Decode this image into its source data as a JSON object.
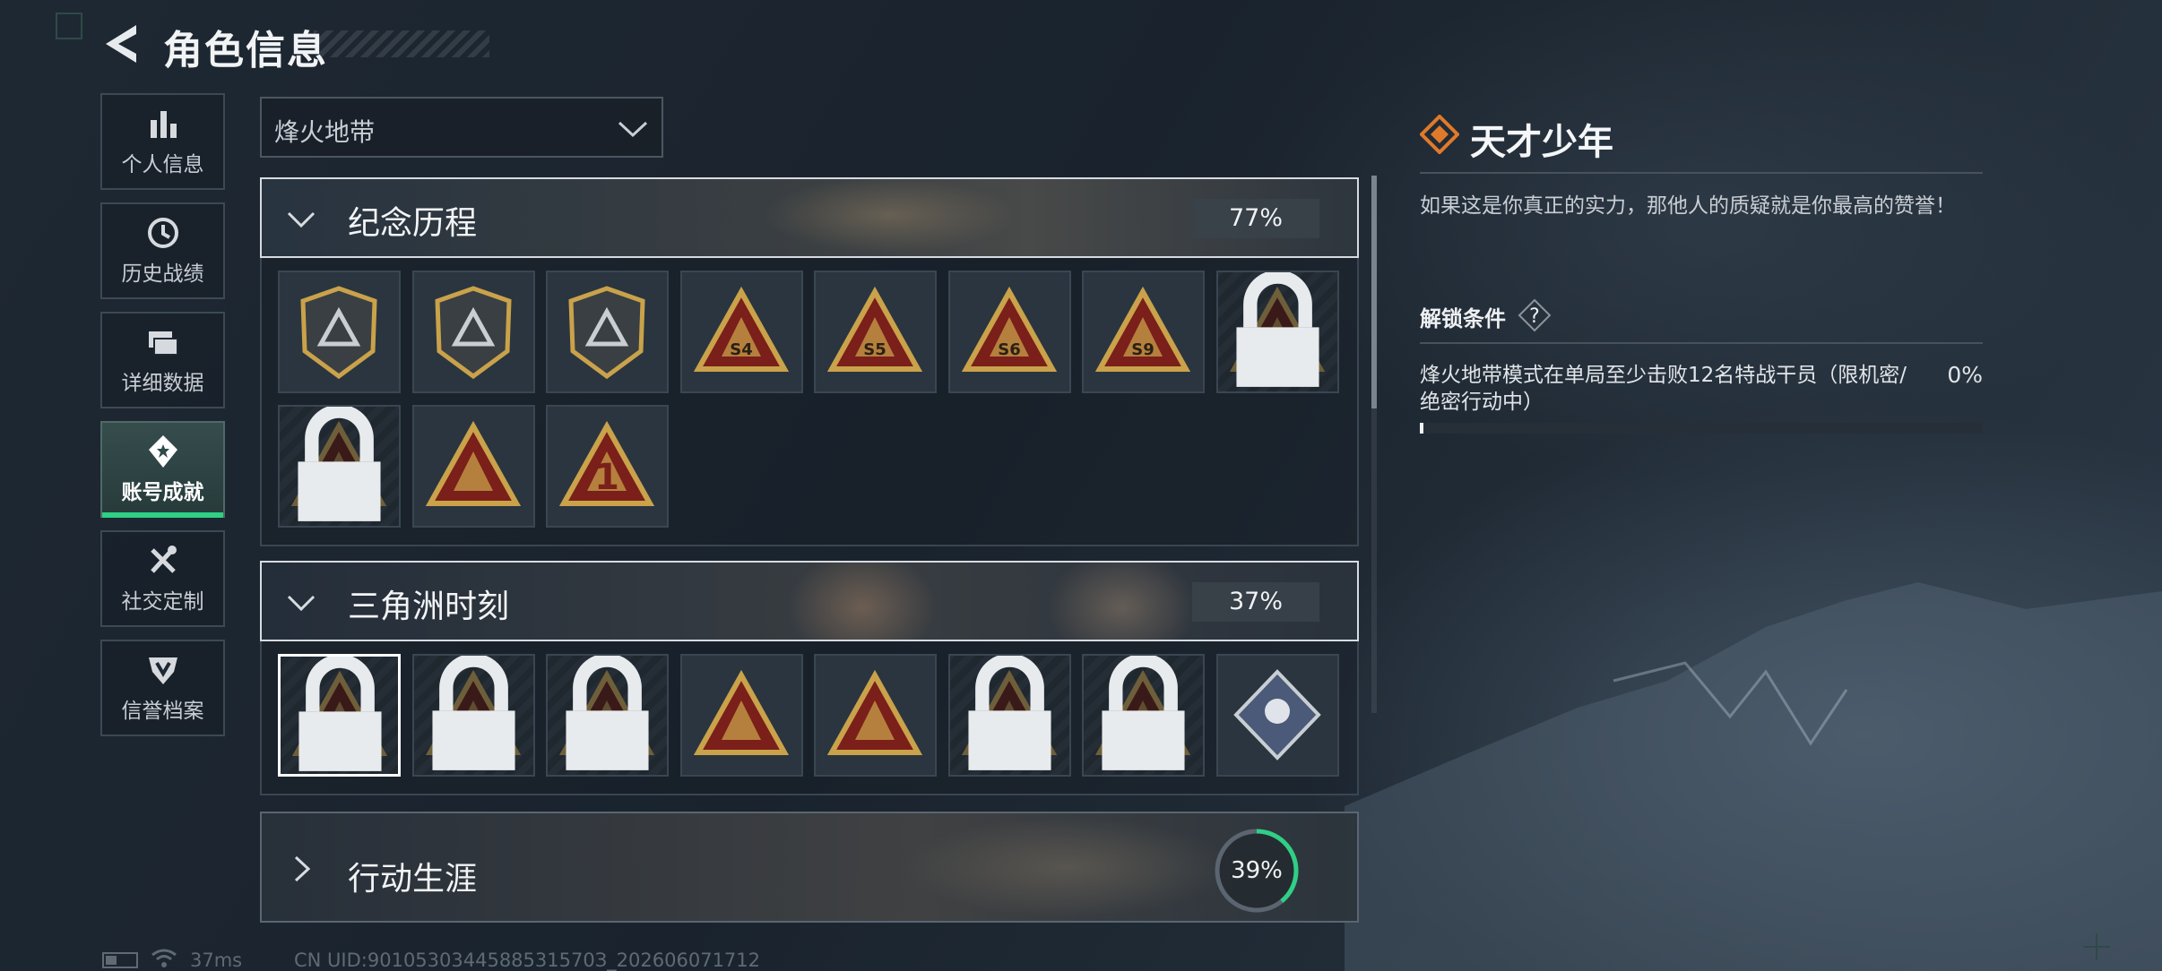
{
  "header": {
    "title": "角色信息"
  },
  "sidebar": {
    "items": [
      {
        "label": "个人信息",
        "icon": "bar-chart-icon"
      },
      {
        "label": "历史战绩",
        "icon": "history-clock-icon"
      },
      {
        "label": "详细数据",
        "icon": "folder-stack-icon"
      },
      {
        "label": "账号成就",
        "icon": "achievement-medal-icon",
        "active": true
      },
      {
        "label": "社交定制",
        "icon": "wrench-tools-icon"
      },
      {
        "label": "信誉档案",
        "icon": "shield-badge-icon"
      }
    ]
  },
  "filter": {
    "selected": "烽火地带"
  },
  "sections": [
    {
      "title": "纪念历程",
      "progress": "77%",
      "expanded": true,
      "badges": [
        {
          "locked": false,
          "mark": ""
        },
        {
          "locked": false,
          "mark": ""
        },
        {
          "locked": false,
          "mark": ""
        },
        {
          "locked": false,
          "mark": "S4"
        },
        {
          "locked": false,
          "mark": "S5"
        },
        {
          "locked": false,
          "mark": "S6"
        },
        {
          "locked": false,
          "mark": "S9"
        },
        {
          "locked": true,
          "mark": ""
        },
        {
          "locked": true,
          "mark": ""
        },
        {
          "locked": false,
          "mark": ""
        },
        {
          "locked": false,
          "mark": "1"
        }
      ]
    },
    {
      "title": "三角洲时刻",
      "progress": "37%",
      "expanded": true,
      "badges": [
        {
          "locked": true,
          "mark": "",
          "selected": true
        },
        {
          "locked": true,
          "mark": ""
        },
        {
          "locked": true,
          "mark": ""
        },
        {
          "locked": false,
          "mark": ""
        },
        {
          "locked": false,
          "mark": ""
        },
        {
          "locked": true,
          "mark": ""
        },
        {
          "locked": true,
          "mark": ""
        },
        {
          "locked": false,
          "mark": ""
        }
      ]
    },
    {
      "title": "行动生涯",
      "progress": "39%",
      "progress_value": 0.39,
      "expanded": false
    }
  ],
  "detail": {
    "title": "天才少年",
    "description": "如果这是你真正的实力，那他人的质疑就是你最高的赞誉！",
    "condition_label": "解锁条件",
    "help_symbol": "?",
    "condition": "烽火地带模式在单局至少击败12名特战干员（限机密/绝密行动中）",
    "condition_progress": "0%",
    "condition_progress_value": 0.0
  },
  "status": {
    "ping": "37ms",
    "uid": "CN UID:9010530344588531570З_202606071712"
  },
  "colors": {
    "accent_green": "#2fcf86",
    "gold": "#c9a24a",
    "badge_red": "#7a1f1a",
    "title_orange": "#e07a2a"
  }
}
